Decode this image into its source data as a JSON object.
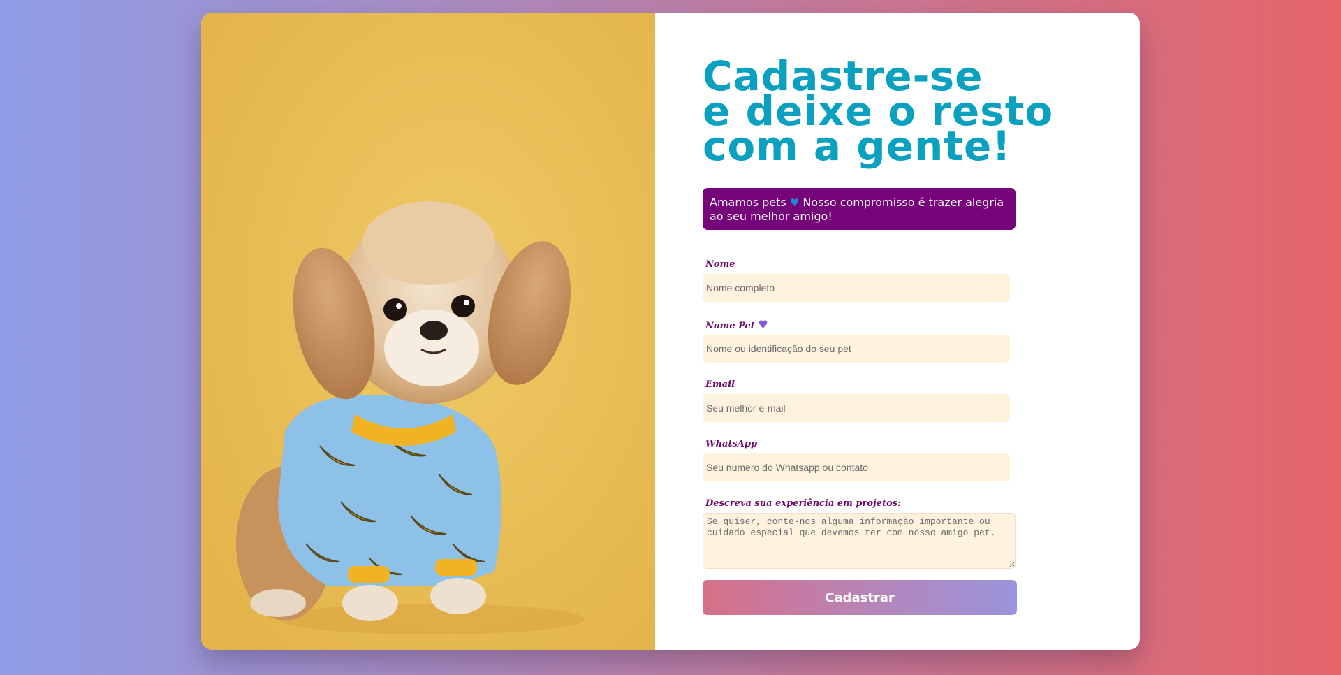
{
  "hero": {
    "title_lines": [
      "Cadastre-se",
      "e deixe o resto",
      "com a gente!"
    ]
  },
  "banner": {
    "text_before": "Amamos pets",
    "heart_icon": "blue-heart-icon",
    "text_after": " Nosso compromisso é trazer alegria ao seu melhor amigo!"
  },
  "form": {
    "nome": {
      "label": "Nome",
      "placeholder": "Nome completo"
    },
    "nome_pet": {
      "label": "Nome Pet",
      "heart_icon": "purple-heart-icon",
      "placeholder": "Nome ou identificação do seu pet"
    },
    "email": {
      "label": "Email",
      "placeholder": "Seu melhor e-mail"
    },
    "whatsapp": {
      "label": "WhatsApp",
      "placeholder": "Seu numero do Whatsapp ou contato"
    },
    "descricao": {
      "label": "Descreva sua experiência em projetos:",
      "placeholder": "Se quiser, conte-nos alguma informação importante ou cuidado especial que devemos ter com nosso amigo pet."
    },
    "submit_label": "Cadastrar"
  },
  "colors": {
    "title": "#0aa0bf",
    "banner_bg": "#75047a",
    "label": "#6d0a6e",
    "field_bg": "#fff2df",
    "photo_bg": "#e8c05a"
  }
}
